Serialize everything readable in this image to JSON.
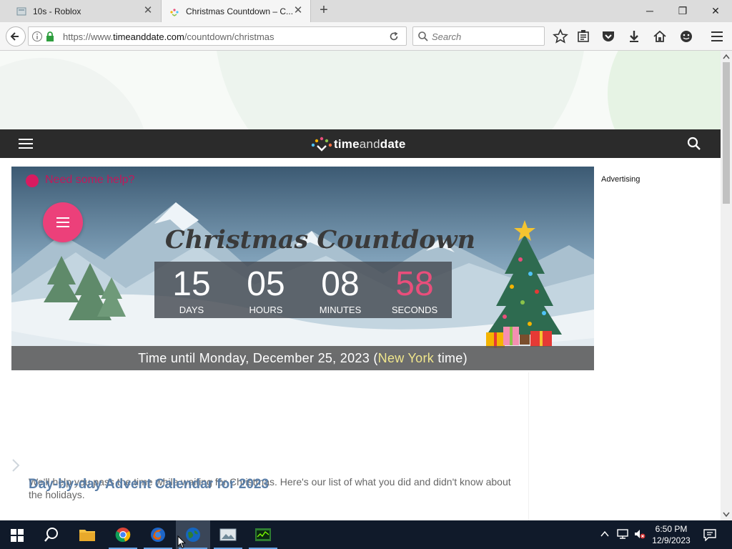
{
  "browser": {
    "tabs": [
      {
        "title": "10s - Roblox",
        "active": false
      },
      {
        "title": "Christmas Countdown – C...",
        "active": true
      }
    ],
    "url": {
      "prefix": "https://www.",
      "host": "timeanddate.com",
      "path": "/countdown/christmas"
    },
    "search_placeholder": "Search"
  },
  "site": {
    "logo_text_a": "time",
    "logo_text_b": "and",
    "logo_text_c": "date",
    "need_help": "Need some help?",
    "advertising_label": "Advertising"
  },
  "countdown": {
    "title": "Christmas Countdown",
    "units": [
      {
        "value": "15",
        "label": "DAYS"
      },
      {
        "value": "05",
        "label": "HOURS"
      },
      {
        "value": "08",
        "label": "MINUTES"
      },
      {
        "value": "58",
        "label": "SECONDS"
      }
    ],
    "until_prefix": "Time until Monday, December 25, 2023 (",
    "until_city": "New York",
    "until_suffix": " time)"
  },
  "article": {
    "advent_title": "Day-by-day Advent Calendar for 2023",
    "advent_desc": "We'll help you pass the time while waiting for Christmas. Here's our list of what you did and didn't know about the holidays."
  },
  "taskbar": {
    "time": "6:50 PM",
    "date": "12/9/2023"
  },
  "colors": {
    "header_bg": "#2b2b2b",
    "accent_pink": "#ec407a",
    "seconds_color": "#e94e7b",
    "taskbar_bg": "#101a2a"
  }
}
